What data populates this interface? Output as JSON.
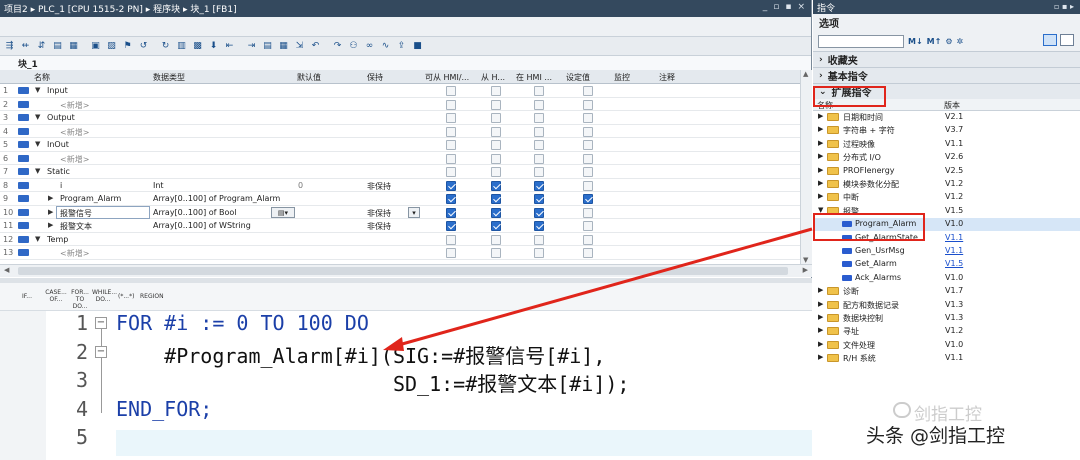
{
  "left_window": {
    "breadcrumb": [
      "项目2",
      "PLC_1 [CPU 1515-2 PN]",
      "程序块",
      "块_1 [FB1]"
    ],
    "block_name": "块_1",
    "window_controls": [
      "_",
      "▫",
      "▪",
      "×"
    ]
  },
  "interface_table": {
    "headers": [
      "名称",
      "数据类型",
      "默认值",
      "保持",
      "可从 HMI/...",
      "从 H...",
      "在 HMI ...",
      "设定值",
      "监控",
      "注释"
    ],
    "rows": [
      {
        "num": "1",
        "tri": "▼",
        "name": "Input",
        "type": "",
        "default": "",
        "retain": "",
        "c1": false,
        "c2": false,
        "c3": false,
        "c4": false,
        "level": 0
      },
      {
        "num": "2",
        "tri": "",
        "name": "<新增>",
        "type": "",
        "default": "",
        "retain": "",
        "c1": false,
        "c2": false,
        "c3": false,
        "c4": false,
        "level": 1,
        "add": true
      },
      {
        "num": "3",
        "tri": "▼",
        "name": "Output",
        "type": "",
        "default": "",
        "retain": "",
        "c1": false,
        "c2": false,
        "c3": false,
        "c4": false,
        "level": 0
      },
      {
        "num": "4",
        "tri": "",
        "name": "<新增>",
        "type": "",
        "default": "",
        "retain": "",
        "c1": false,
        "c2": false,
        "c3": false,
        "c4": false,
        "level": 1,
        "add": true
      },
      {
        "num": "5",
        "tri": "▼",
        "name": "InOut",
        "type": "",
        "default": "",
        "retain": "",
        "c1": false,
        "c2": false,
        "c3": false,
        "c4": false,
        "level": 0
      },
      {
        "num": "6",
        "tri": "",
        "name": "<新增>",
        "type": "",
        "default": "",
        "retain": "",
        "c1": false,
        "c2": false,
        "c3": false,
        "c4": false,
        "level": 1,
        "add": true
      },
      {
        "num": "7",
        "tri": "▼",
        "name": "Static",
        "type": "",
        "default": "",
        "retain": "",
        "c1": false,
        "c2": false,
        "c3": false,
        "c4": false,
        "level": 0
      },
      {
        "num": "8",
        "tri": "",
        "name": "i",
        "type": "Int",
        "default": "0",
        "retain": "非保持",
        "c1": true,
        "c2": true,
        "c3": true,
        "c4": false,
        "level": 1
      },
      {
        "num": "9",
        "tri": "▶",
        "name": "Program_Alarm",
        "type": "Array[0..100] of Program_Alarm",
        "default": "",
        "retain": "",
        "c1": true,
        "c2": true,
        "c3": true,
        "c4": true,
        "level": 1
      },
      {
        "num": "10",
        "tri": "▶",
        "name": "报警信号",
        "type": "Array[0..100] of Bool",
        "default": "",
        "retain": "非保持",
        "c1": true,
        "c2": true,
        "c3": true,
        "c4": false,
        "level": 1
      },
      {
        "num": "11",
        "tri": "▶",
        "name": "报警文本",
        "type": "Array[0..100] of WString",
        "default": "",
        "retain": "非保持",
        "c1": true,
        "c2": true,
        "c3": true,
        "c4": false,
        "level": 1
      },
      {
        "num": "12",
        "tri": "▼",
        "name": "Temp",
        "type": "",
        "default": "",
        "retain": "",
        "c1": false,
        "c2": false,
        "c3": false,
        "c4": false,
        "level": 0
      },
      {
        "num": "13",
        "tri": "",
        "name": "<新增>",
        "type": "",
        "default": "",
        "retain": "",
        "c1": false,
        "c2": false,
        "c3": false,
        "c4": false,
        "level": 1,
        "add": true
      }
    ]
  },
  "scl_toolbar": [
    "IF...",
    "CASE... OF...",
    "FOR... TO DO...",
    "WHILE... DO...",
    "(*...*)",
    "REGION"
  ],
  "code": {
    "lines": [
      {
        "num": "1",
        "text": "FOR #i := 0 TO 100 DO",
        "fold": "−"
      },
      {
        "num": "2",
        "text": "    #Program_Alarm[#i](SIG:=#报警信号[#i],",
        "fold": "−"
      },
      {
        "num": "3",
        "text": "                       SD_1:=#报警文本[#i]);",
        "fold": ""
      },
      {
        "num": "4",
        "text": "END_FOR;",
        "fold": ""
      },
      {
        "num": "5",
        "text": "",
        "fold": ""
      }
    ]
  },
  "instructions_panel": {
    "title": "指令",
    "options_label": "选项",
    "sections": {
      "favorites": "收藏夹",
      "basic": "基本指令",
      "extended": "扩展指令"
    },
    "columns": {
      "name": "名称",
      "version": "版本"
    },
    "items": [
      {
        "name": "日期和时间",
        "version": "V2.1",
        "type": "folder"
      },
      {
        "name": "字符串 + 字符",
        "version": "V3.7",
        "type": "folder"
      },
      {
        "name": "过程映像",
        "version": "V1.1",
        "type": "folder"
      },
      {
        "name": "分布式 I/O",
        "version": "V2.6",
        "type": "folder"
      },
      {
        "name": "PROFIenergy",
        "version": "V2.5",
        "type": "folder"
      },
      {
        "name": "模块参数化分配",
        "version": "V1.2",
        "type": "folder"
      },
      {
        "name": "中断",
        "version": "V1.2",
        "type": "folder"
      },
      {
        "name": "报警",
        "version": "V1.5",
        "type": "open-folder"
      },
      {
        "name": "Program_Alarm",
        "version": "V1.0",
        "type": "fb",
        "selected": true
      },
      {
        "name": "Get_AlarmState",
        "version": "V1.1",
        "type": "fb",
        "link": true
      },
      {
        "name": "Gen_UsrMsg",
        "version": "V1.1",
        "type": "fb",
        "link": true
      },
      {
        "name": "Get_Alarm",
        "version": "V1.5",
        "type": "fb",
        "link": true
      },
      {
        "name": "Ack_Alarms",
        "version": "V1.0",
        "type": "fb"
      },
      {
        "name": "诊断",
        "version": "V1.7",
        "type": "folder"
      },
      {
        "name": "配方和数据记录",
        "version": "V1.3",
        "type": "folder"
      },
      {
        "name": "数据块控制",
        "version": "V1.3",
        "type": "folder"
      },
      {
        "name": "寻址",
        "version": "V1.2",
        "type": "folder"
      },
      {
        "name": "文件处理",
        "version": "V1.0",
        "type": "folder"
      },
      {
        "name": "R/H 系统",
        "version": "V1.1",
        "type": "folder"
      }
    ]
  },
  "watermark": {
    "faint": "剑指工控",
    "main": "头条 @剑指工控"
  },
  "colors": {
    "titlebar": "#34495e",
    "accent": "#2a6ecb",
    "annotation_red": "#e0251b"
  }
}
